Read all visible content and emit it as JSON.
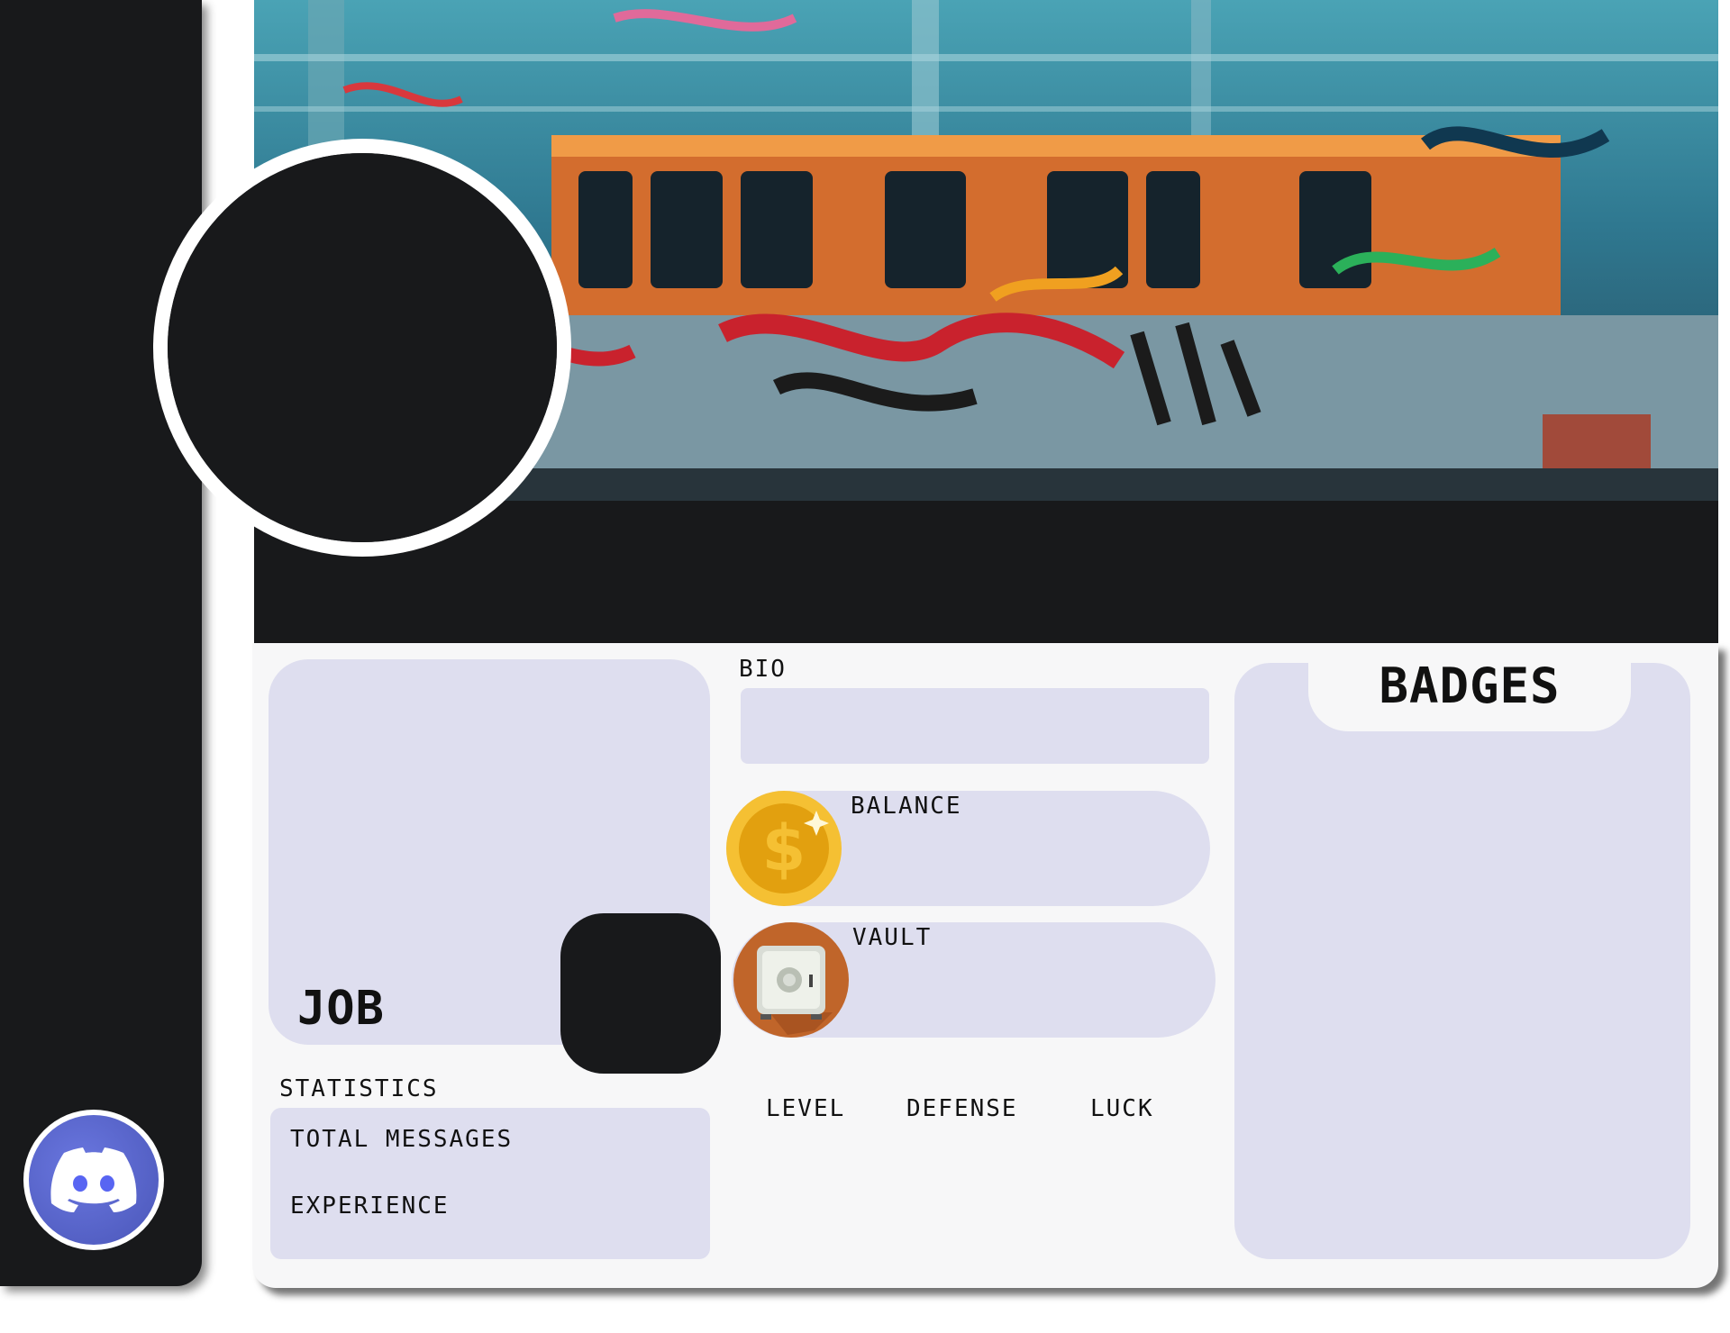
{
  "profile": {
    "bio_label": "BIO",
    "balance_label": "BALANCE",
    "vault_label": "VAULT",
    "job_label": "JOB",
    "statistics": {
      "title": "STATISTICS",
      "total_messages_label": "TOTAL MESSAGES",
      "experience_label": "EXPERIENCE"
    },
    "attributes": {
      "level_label": "LEVEL",
      "defense_label": "DEFENSE",
      "luck_label": "LUCK"
    },
    "badges_label": "BADGES"
  },
  "icons": {
    "coin": "dollar-coin-icon",
    "vault": "safe-icon",
    "discord": "discord-icon"
  },
  "colors": {
    "panel": "#dedeef",
    "dark": "#18191b",
    "card": "#f7f7f8",
    "coin_gold": "#e9a50c",
    "vault_orange": "#c0652a",
    "discord": "#5865f2"
  }
}
